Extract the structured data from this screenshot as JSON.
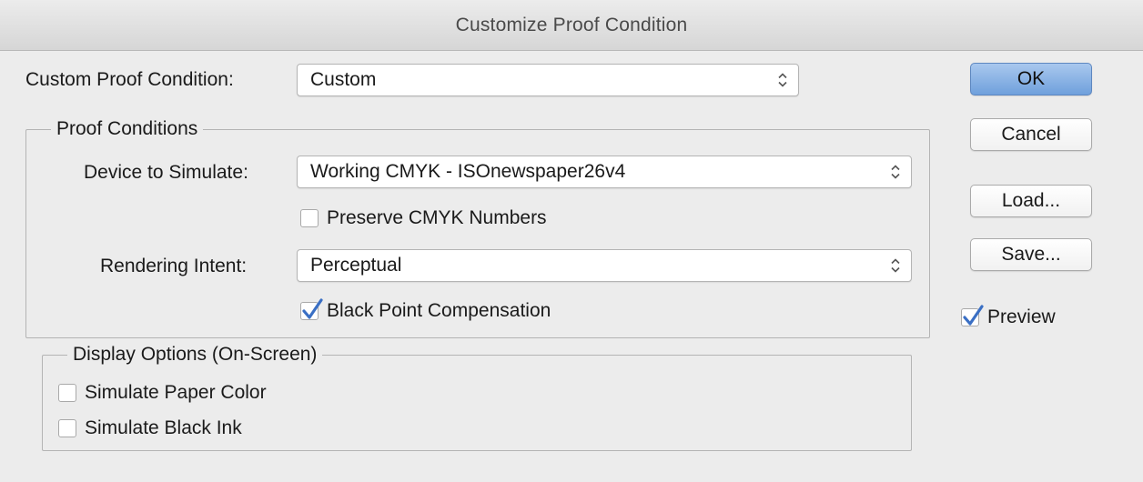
{
  "window": {
    "title": "Customize Proof Condition"
  },
  "custom_condition": {
    "label": "Custom Proof Condition:",
    "value": "Custom"
  },
  "proof_conditions": {
    "group_label": "Proof Conditions",
    "device_label": "Device to Simulate:",
    "device_value": "Working CMYK - ISOnewspaper26v4",
    "preserve_label": "Preserve CMYK Numbers",
    "preserve_checked": false,
    "intent_label": "Rendering Intent:",
    "intent_value": "Perceptual",
    "bpc_label": "Black Point Compensation",
    "bpc_checked": true
  },
  "display_options": {
    "group_label": "Display Options (On-Screen)",
    "paper_label": "Simulate Paper Color",
    "paper_checked": false,
    "ink_label": "Simulate Black Ink",
    "ink_checked": false
  },
  "buttons": {
    "ok": "OK",
    "cancel": "Cancel",
    "load": "Load...",
    "save": "Save..."
  },
  "preview": {
    "label": "Preview",
    "checked": true
  },
  "colors": {
    "accent": "#6fa0dc",
    "checkmark": "#3a6fc4"
  },
  "icons": {
    "popup_arrows": "up-down-chevron-icon",
    "checkmark": "checkmark-icon"
  }
}
